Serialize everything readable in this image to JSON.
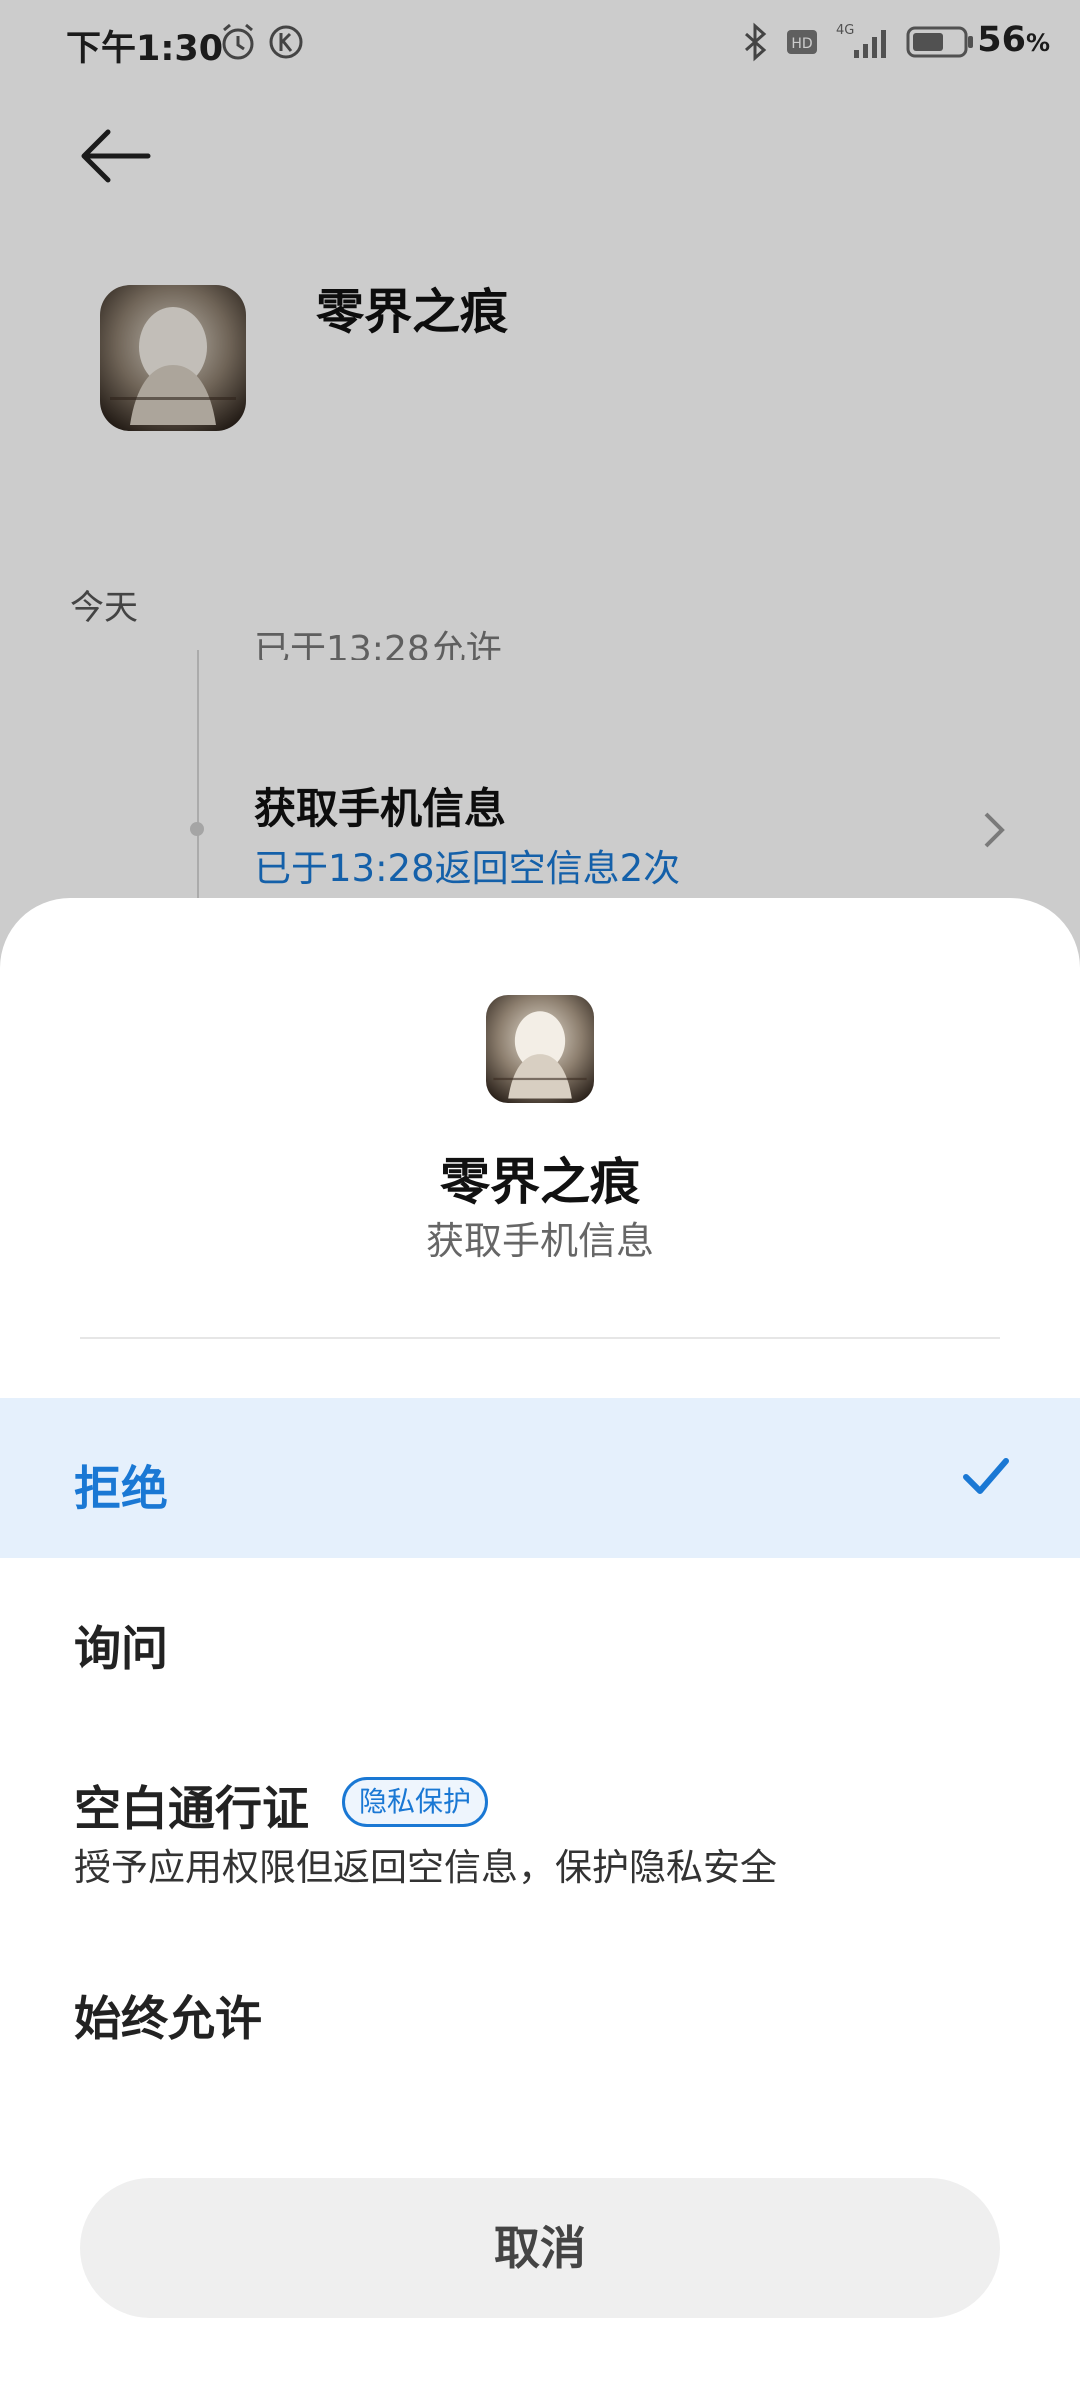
{
  "status_bar": {
    "time": "下午1:30",
    "battery_percent": "56",
    "battery_unit": "%",
    "network_label": "4G",
    "hd_label": "HD"
  },
  "page": {
    "app_name": "零界之痕",
    "section_label": "今天",
    "partial_entry_text": "已于13:28允许",
    "entry_title": "获取手机信息",
    "entry_subtitle": "已于13:28返回空信息2次"
  },
  "sheet": {
    "app_name": "零界之痕",
    "permission": "获取手机信息",
    "options": [
      {
        "label": "拒绝",
        "selected": true
      },
      {
        "label": "询问",
        "selected": false
      },
      {
        "label": "空白通行证",
        "badge": "隐私保护",
        "description": "授予应用权限但返回空信息，保护隐私安全",
        "selected": false
      },
      {
        "label": "始终允许",
        "selected": false
      }
    ],
    "cancel_label": "取消"
  },
  "colors": {
    "accent": "#1a78d4",
    "selected_bg": "#e5f0fc",
    "cancel_bg": "#efefef"
  }
}
